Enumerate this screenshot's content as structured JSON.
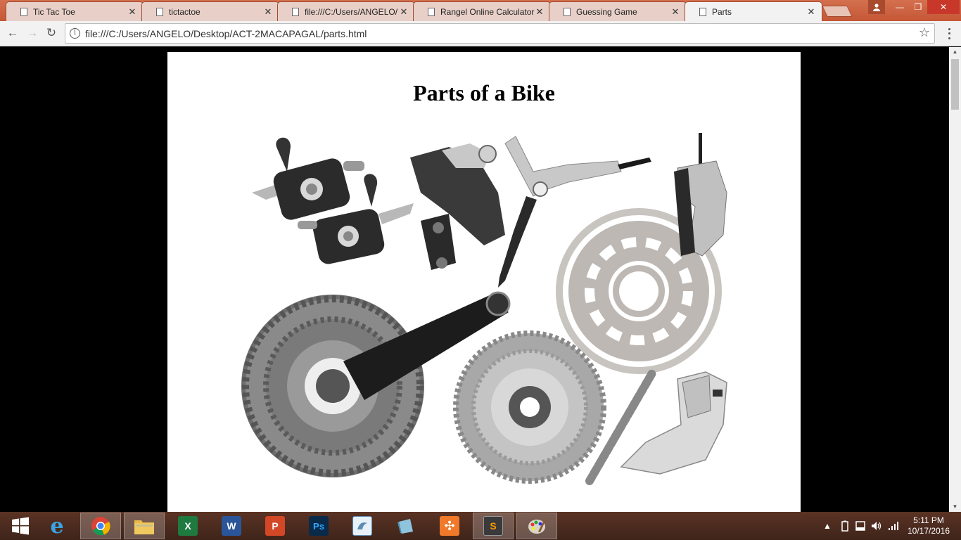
{
  "browser": {
    "tabs": [
      {
        "title": "Tic Tac Toe",
        "active": false
      },
      {
        "title": "tictactoe",
        "active": false
      },
      {
        "title": "file:///C:/Users/ANGELO/",
        "active": false
      },
      {
        "title": "Rangel Online Calculator",
        "active": false
      },
      {
        "title": "Guessing Game",
        "active": false
      },
      {
        "title": "Parts",
        "active": true
      }
    ],
    "close_glyph": "✕",
    "url": "file:///C:/Users/ANGELO/Desktop/ACT-2MACAPAGAL/parts.html",
    "info_glyph": "i",
    "back_glyph": "←",
    "forward_glyph": "→",
    "reload_glyph": "↻",
    "star_glyph": "☆",
    "window": {
      "minimize": "—",
      "maximize": "❐",
      "close": "✕"
    }
  },
  "page": {
    "heading": "Parts of a Bike",
    "image_alt": "Bike parts: shifters, rear derailleur, brake lever, disc rotor with caliper, crankset, cassette, chain, front derailleur"
  },
  "taskbar": {
    "apps": [
      {
        "name": "internet-explorer",
        "label": "e",
        "color": "#1e8fd6"
      },
      {
        "name": "chrome",
        "label": "",
        "color": "#dd4433",
        "active": true
      },
      {
        "name": "file-explorer",
        "label": "",
        "color": "#e8b84a"
      },
      {
        "name": "excel",
        "label": "X",
        "color": "#1f7a3f"
      },
      {
        "name": "word",
        "label": "W",
        "color": "#2a5699"
      },
      {
        "name": "powerpoint",
        "label": "P",
        "color": "#d24726"
      },
      {
        "name": "photoshop",
        "label": "Ps",
        "color": "#0a2a4a"
      },
      {
        "name": "mysql-installer",
        "label": "",
        "color": "#5b8db8"
      },
      {
        "name": "app-blue",
        "label": "",
        "color": "#6aa8c8"
      },
      {
        "name": "xampp",
        "label": "✣",
        "color": "#f07a2a"
      },
      {
        "name": "sublime-text",
        "label": "S",
        "color": "#3a3a3a"
      },
      {
        "name": "paint",
        "label": "",
        "color": "#a8a8b8"
      }
    ],
    "time": "5:11 PM",
    "date": "10/17/2016"
  }
}
